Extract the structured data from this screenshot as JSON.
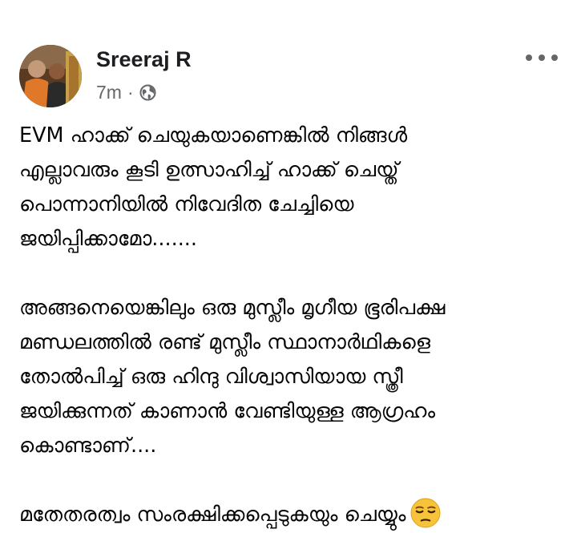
{
  "post": {
    "author": "Sreeraj R",
    "time": "7m",
    "separator": "·",
    "privacy_icon": "globe-icon",
    "more_icon": "more-horizontal-icon",
    "paragraphs": [
      [
        "EVM ഹാക്ക് ചെയുകയാണെങ്കിൽ നിങ്ങൾ",
        "എല്ലാവരും കൂടി ഉത്സാഹിച്ച് ഹാക്ക് ചെയ്ത്",
        "പൊന്നാനിയിൽ നിവേദിത ചേച്ചിയെ",
        "ജയിപ്പിക്കാമോ......."
      ],
      [
        "അങ്ങനെയെങ്കിലും ഒരു മുസ്ലീം മൃഗീയ ഭൂരിപക്ഷ",
        "മണ്ഡലത്തിൽ രണ്ട് മുസ്ലീം സ്ഥാനാർഥികളെ",
        "തോൽപിച്ച് ഒരു ഹിന്ദു വിശ്വാസിയായ സ്ത്രീ",
        "ജയിക്കുന്നത് കാണാൻ വേണ്ടിയുള്ള ആഗ്രഹം",
        "കൊണ്ടാണ്...."
      ],
      [
        "മതേതരത്വം സംരക്ഷിക്കപ്പെടുകയും ചെയ്യും"
      ]
    ],
    "emoji": "unamused-face-icon"
  },
  "colors": {
    "text": "#050505",
    "meta": "#65676b",
    "emoji_face": "#f6c33a"
  }
}
